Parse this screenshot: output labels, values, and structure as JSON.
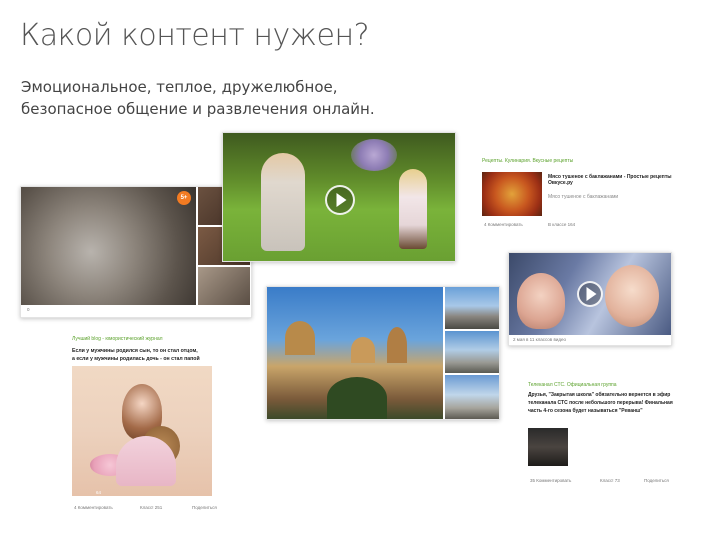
{
  "slide": {
    "title": "Какой контент нужен?",
    "subtitle_line1": "Эмоциональное, теплое, дружелюбное,",
    "subtitle_line2": "безопасное общение и развлечения онлайн."
  },
  "cards": {
    "recipes": {
      "group": "Рецепты. Кулинария. Вкусные рецепты",
      "post_title": "Мясо тушеное с баклажанами - Простые рецепты Овкусе.ру",
      "post_sub": "Мясо тушеное с баклажанами",
      "footer": "В классе 164",
      "comments": "4 Комментировать"
    },
    "kids_video": {
      "caption": "2 мая в 11 классов видео"
    },
    "cat": {
      "badge": "5+",
      "count": "0"
    },
    "humor": {
      "group": "Лучший blog - юмористический журнал",
      "text_line1": "Если у мужчины родился сын, то он стал отцом,",
      "text_line2": "а если у мужчины родилась дочь - он стал папой",
      "likes": "64",
      "comments": "4 Комментировать",
      "class": "Класс! 251",
      "share": "Поделиться"
    },
    "ctc": {
      "group": "Телеканал СТС. Официальная группа",
      "line1": "Друзья, \"Закрытая школа\" обязательно вернется в эфир",
      "line2": "телеканала СТС после небольшого перерыва! Финальная",
      "line3": "часть 4-го сезона будет называться \"Реванш\"",
      "comments": "35 Комментировать",
      "class": "Класс! 73",
      "share": "Поделиться"
    }
  }
}
